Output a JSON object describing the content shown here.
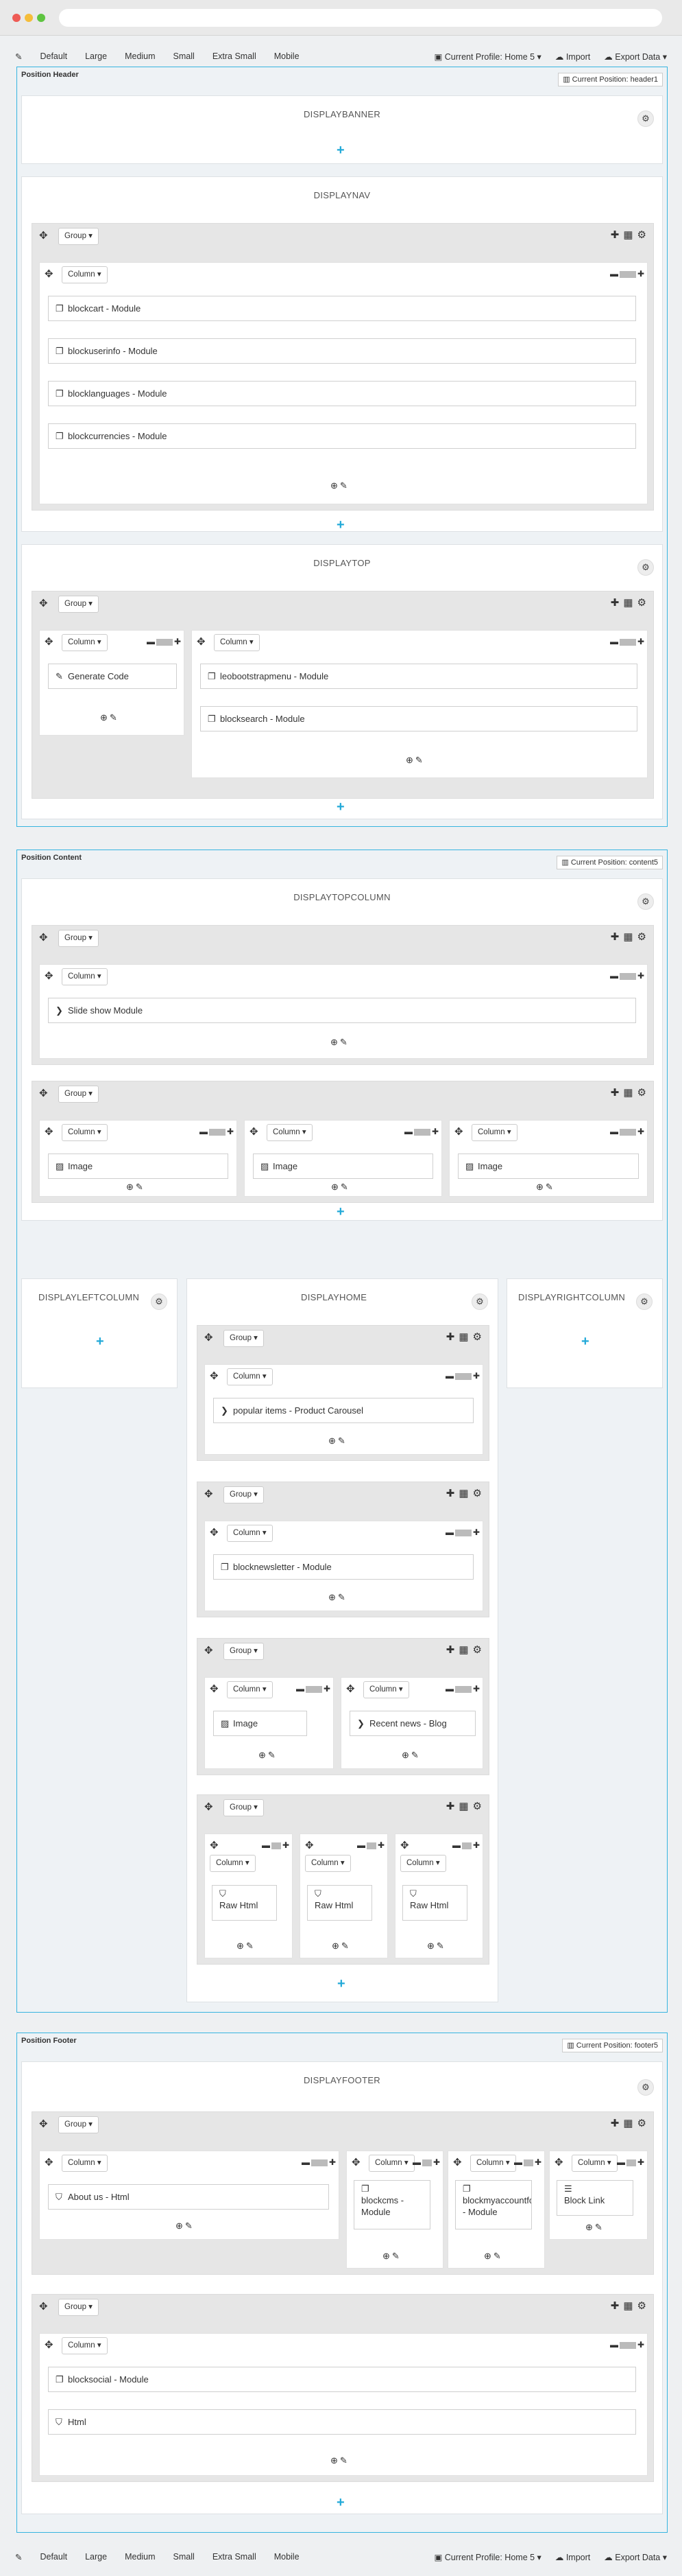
{
  "toolbar": {
    "edit_icon": "wand-icon",
    "sizes": [
      "Default",
      "Large",
      "Medium",
      "Small",
      "Extra Small",
      "Mobile"
    ],
    "profile": "Current Profile: Home 5 ▾",
    "import": "Import",
    "export": "Export Data ▾"
  },
  "common": {
    "group": "Group",
    "column": "Column"
  },
  "positions": {
    "header": {
      "title": "Position Header",
      "current": "Current Position: header1"
    },
    "content": {
      "title": "Position Content",
      "current": "Current Position: content5"
    },
    "footer": {
      "title": "Position Footer",
      "current": "Current Position: footer5"
    }
  },
  "hooks": {
    "displaybanner": "DISPLAYBANNER",
    "displaynav": "DISPLAYNAV",
    "displaytop": "DISPLAYTOP",
    "displaytopcolumn": "DISPLAYTOPCOLUMN",
    "displayleftcolumn": "DISPLAYLEFTCOLUMN",
    "displayhome": "DISPLAYHOME",
    "displayrightcolumn": "DISPLAYRIGHTCOLUMN",
    "displayfooter": "DISPLAYFOOTER"
  },
  "modules": {
    "nav": [
      "blockcart - Module",
      "blockuserinfo - Module",
      "blocklanguages - Module",
      "blockcurrencies - Module"
    ],
    "top_left": "Generate Code",
    "top_right": [
      "leobootstrapmenu - Module",
      "blocksearch - Module"
    ],
    "slideshow": "Slide show Module",
    "image": "Image",
    "carousel": "popular items - Product Carousel",
    "newsletter": "blocknewsletter - Module",
    "recent_news": "Recent news - Blog",
    "raw_html": "Raw Html",
    "about": "About us - Html",
    "blockcms": "blockcms - Module",
    "blockmyaccount": "blockmyaccountfooter - Module",
    "block_link": "Block Link",
    "blocksocial": "blocksocial - Module",
    "html": "Html"
  }
}
